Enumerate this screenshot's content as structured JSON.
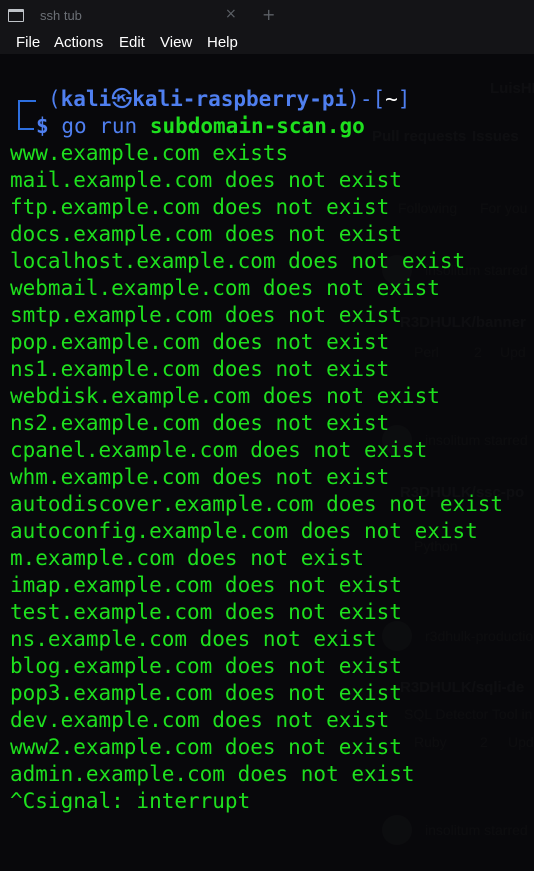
{
  "window": {
    "tab_title": "ssh tub",
    "tab_close": "×",
    "tab_add": "+"
  },
  "menu": [
    "File",
    "Actions",
    "Edit",
    "View",
    "Help"
  ],
  "prompt": {
    "open_paren": "(",
    "user": "kali",
    "at_symbol": "㉿",
    "host": "kali-raspberry-pi",
    "mid": ")-[",
    "dir": "~",
    "close": "]",
    "dollar": "$",
    "cmd_prefix": "go run ",
    "cmd_file": "subdomain-scan.go"
  },
  "output": [
    "www.example.com exists",
    "mail.example.com does not exist",
    "ftp.example.com does not exist",
    "docs.example.com does not exist",
    "localhost.example.com does not exist",
    "webmail.example.com does not exist",
    "smtp.example.com does not exist",
    "pop.example.com does not exist",
    "ns1.example.com does not exist",
    "webdisk.example.com does not exist",
    "ns2.example.com does not exist",
    "cpanel.example.com does not exist",
    "whm.example.com does not exist",
    "autodiscover.example.com does not exist",
    "autoconfig.example.com does not exist",
    "m.example.com does not exist",
    "imap.example.com does not exist",
    "test.example.com does not exist",
    "ns.example.com does not exist",
    "blog.example.com does not exist",
    "pop3.example.com does not exist",
    "dev.example.com does not exist",
    "www2.example.com does not exist",
    "admin.example.com does not exist",
    "^Csignal: interrupt"
  ],
  "background_page": {
    "user_link": "LuisHI",
    "pull_requests": "Pull requests",
    "issues": "Issues",
    "tab_following": "Following",
    "tab_for_you": "For you",
    "item1_actor": "insolitum starred",
    "item1_repo": "R3DHULK/banner",
    "item1_lang": "Perl",
    "item1_stars": "2",
    "item1_updated": "Upd",
    "item2_actor": "insolitum starred",
    "item2_repo": "R3DHULK/ssc-po",
    "item2_lang": "Python",
    "item3_actor": "r3dhulk-production",
    "item3_repo": "R3DHULK/sqli-de",
    "item3_desc": "SQL Detector Tool in",
    "item3_lang": "Ruby",
    "item3_stars": "2",
    "item3_updated": "Upd",
    "item4_actor": "insolitum starred"
  }
}
